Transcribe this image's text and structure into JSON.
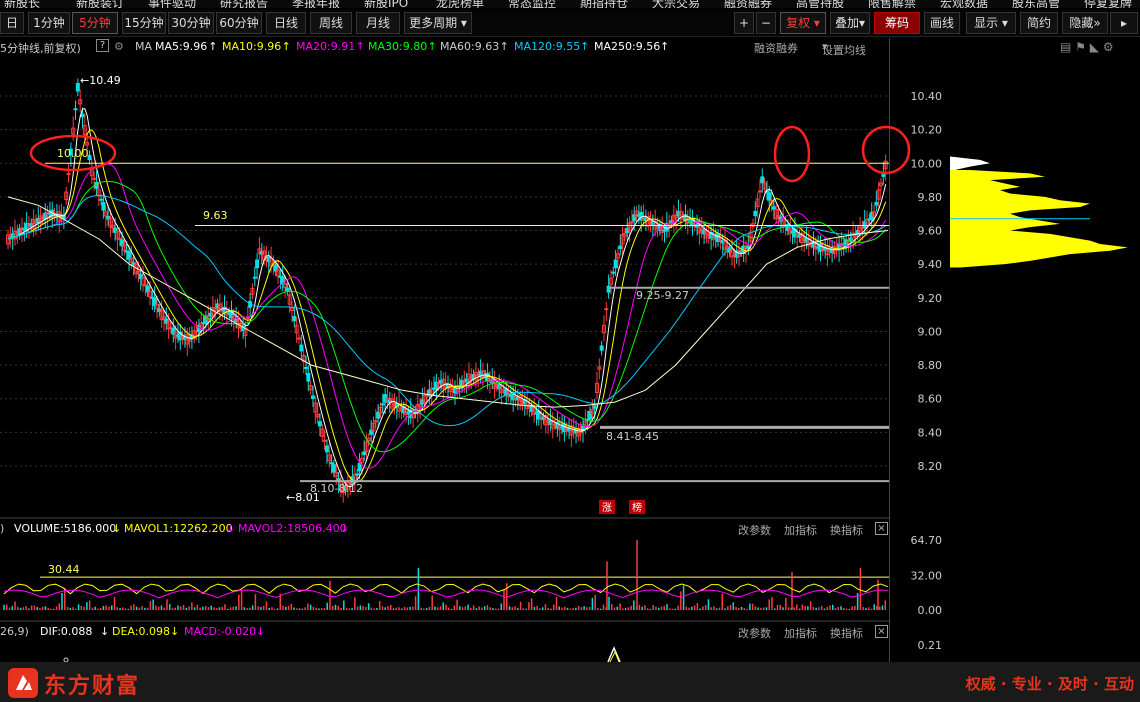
{
  "top_nav": [
    "新股长",
    "新股装订",
    "事件驱动",
    "研究报告",
    "季报年报",
    "新股IPO",
    "龙虎榜单",
    "常态监控",
    "期指持仓",
    "大宗交易",
    "融资融券",
    "高管持股",
    "限售解禁",
    "宏观数据",
    "股东高管",
    "停复复牌"
  ],
  "period_bar": {
    "day_label": "日",
    "periods": [
      "1分钟",
      "5分钟",
      "15分钟",
      "30分钟",
      "60分钟",
      "日线",
      "周线",
      "月线"
    ],
    "active": "5分钟",
    "more": "更多周期",
    "plus": "+",
    "minus": "−",
    "fuquan": "复权",
    "diejia": "叠加",
    "chouma": "筹码",
    "huaxian": "画线",
    "xianshi": "显示",
    "jianyue": "简约",
    "yincang": "隐藏"
  },
  "ma_bar": {
    "title": "5分钟线,前复权)",
    "help": "?",
    "ma_label": "MA",
    "items": [
      {
        "label": "MA5:9.96",
        "color": "#ffffff"
      },
      {
        "label": "MA10:9.96",
        "color": "#ffff00"
      },
      {
        "label": "MA20:9.91",
        "color": "#ff00ff"
      },
      {
        "label": "MA30:9.80",
        "color": "#00ff00"
      },
      {
        "label": "MA60:9.63",
        "color": "#cccccc"
      },
      {
        "label": "MA120:9.55",
        "color": "#00ccff"
      },
      {
        "label": "MA250:9.56",
        "color": "#ffffff"
      }
    ],
    "rzrq": "融资融券",
    "settings": "设置均线"
  },
  "annotations": {
    "high": "10.49",
    "level_a": "10.00",
    "level_b": "9.63",
    "low": "8.01",
    "range1": "8.10-8.12",
    "range2": "8.41-8.45",
    "range3": "9.25-9.27",
    "badge_up": "涨",
    "badge_list": "榜"
  },
  "volume_bar": {
    "title": "VOLUME:5186.000",
    "mavol1": "MAVOL1:12262.200",
    "mavol2": "MAVOL2:18506.400",
    "level": "30.44",
    "change": "改参数",
    "add": "加指标",
    "swap": "换指标",
    "close": "×"
  },
  "macd_bar": {
    "params": "26,9)",
    "dif": "DIF:0.088",
    "dea": "DEA:0.098",
    "macd": "MACD:-0.020",
    "change": "改参数",
    "add": "加指标",
    "swap": "换指标",
    "close": "×"
  },
  "footer": {
    "brand": "东方财富",
    "slogan": "权威 · 专业 · 及时 · 互动"
  },
  "colors": {
    "up": "#ff3b3b",
    "down": "#00e0e0",
    "accent": "#e8331d",
    "level_line": "#ffff66"
  },
  "chart_data": {
    "type": "candlestick",
    "title": "5分钟线 前复权",
    "price_axis": {
      "ticks": [
        10.4,
        10.2,
        10.0,
        9.8,
        9.6,
        9.4,
        9.2,
        9.0,
        8.8,
        8.6,
        8.4,
        8.2
      ],
      "range": [
        8.03,
        10.6
      ]
    },
    "volume_axis": {
      "ticks": [
        64.7,
        32.0,
        0.0
      ],
      "range": [
        0,
        64.7
      ]
    },
    "macd_axis": {
      "ticks": [
        0.21
      ]
    },
    "price_path": [
      9.55,
      9.6,
      9.65,
      9.7,
      9.68,
      10.45,
      9.95,
      9.7,
      9.55,
      9.4,
      9.25,
      9.1,
      8.98,
      8.95,
      9.05,
      9.15,
      9.1,
      9.0,
      9.48,
      9.4,
      9.25,
      8.9,
      8.55,
      8.25,
      8.05,
      8.15,
      8.4,
      8.6,
      8.55,
      8.5,
      8.62,
      8.7,
      8.65,
      8.72,
      8.75,
      8.68,
      8.62,
      8.58,
      8.5,
      8.45,
      8.42,
      8.4,
      8.55,
      9.25,
      9.55,
      9.7,
      9.65,
      9.6,
      9.7,
      9.65,
      9.58,
      9.55,
      9.45,
      9.5,
      9.9,
      9.7,
      9.6,
      9.55,
      9.5,
      9.48,
      9.52,
      9.6,
      9.7,
      10.05
    ],
    "ma250_path": [
      9.8,
      9.75,
      9.65,
      9.55,
      9.4,
      9.3,
      9.2,
      9.1,
      9.0,
      8.9,
      8.8,
      8.75,
      8.7,
      8.65,
      8.62,
      8.6,
      8.58,
      8.56,
      8.55,
      8.56,
      8.58,
      8.65,
      8.8,
      9.0,
      9.2,
      9.4,
      9.5,
      9.55,
      9.58,
      9.6
    ],
    "volume_level": 30.44,
    "volume_spikes": [
      8,
      12,
      6,
      10,
      25,
      10,
      8,
      12,
      20,
      9,
      7,
      11,
      8,
      6,
      10,
      14,
      9,
      7,
      6,
      8,
      10,
      45,
      64.7,
      10,
      8,
      12,
      7,
      35,
      9,
      8,
      12,
      28
    ]
  }
}
